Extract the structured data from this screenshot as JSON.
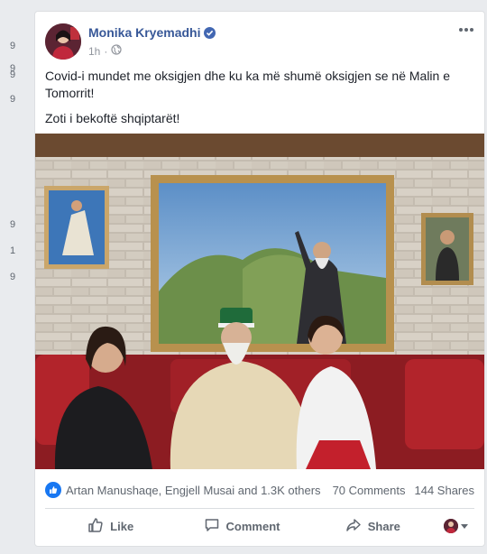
{
  "gutter": {
    "numbers": [
      "9",
      "9",
      "9",
      "9",
      "9",
      "1",
      "9"
    ]
  },
  "post": {
    "author": "Monika Kryemadhi",
    "time": "1h",
    "text": {
      "line1": "Covid-i mundet me oksigjen dhe ku ka më shumë oksigjen se në Malin e Tomorrit!",
      "line2": "Zoti i bekoftë shqiptarët!"
    },
    "reactors": "Artan Manushaqe, Engjell Musai and 1.3K others",
    "comments": "70 Comments",
    "shares": "144 Shares"
  },
  "actions": {
    "like": "Like",
    "comment": "Comment",
    "share": "Share"
  },
  "icons": {
    "verified": "verified-badge-icon",
    "audience": "globe-icon",
    "more": "more-options-icon",
    "like_reaction": "thumbs-up-icon"
  },
  "colors": {
    "author_link": "#385898",
    "like_blue": "#1877f2",
    "muted_text": "#606770",
    "background": "#e9ebee"
  }
}
